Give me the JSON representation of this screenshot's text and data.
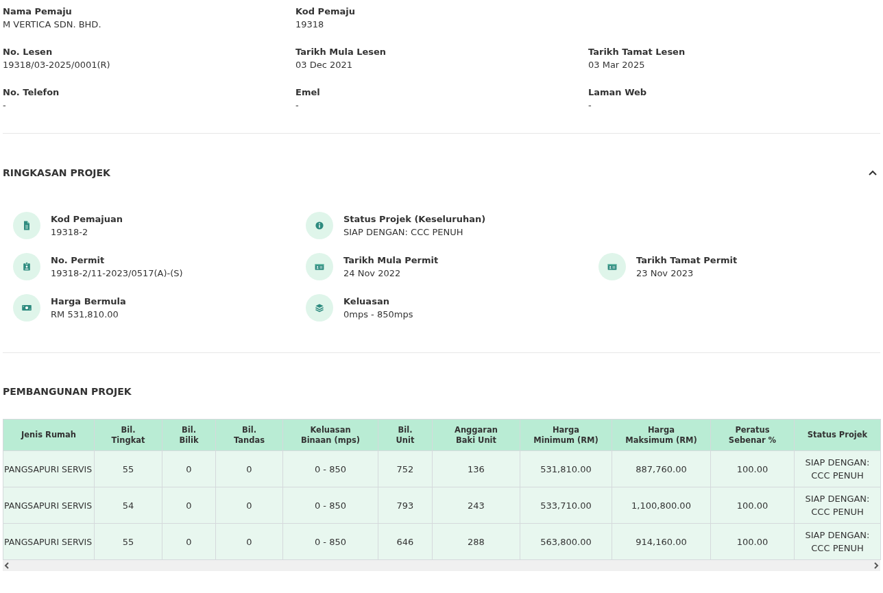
{
  "developer": {
    "rows": [
      [
        {
          "label": "Nama Pemaju",
          "value": "M VERTICA SDN. BHD."
        },
        {
          "label": "Kod Pemaju",
          "value": "19318"
        }
      ],
      [
        {
          "label": "No. Lesen",
          "value": "19318/03-2025/0001(R)"
        },
        {
          "label": "Tarikh Mula Lesen",
          "value": "03 Dec 2021"
        },
        {
          "label": "Tarikh Tamat Lesen",
          "value": "03 Mar 2025"
        }
      ],
      [
        {
          "label": "No. Telefon",
          "value": "-"
        },
        {
          "label": "Emel",
          "value": "-"
        },
        {
          "label": "Laman Web",
          "value": "-"
        }
      ]
    ]
  },
  "summary": {
    "title": "RINGKASAN PROJEK",
    "expanded": true,
    "rows": [
      [
        {
          "kind": "file",
          "label": "Kod Pemajuan",
          "value": "19318-2"
        },
        {
          "kind": "info",
          "label": "Status Projek (Keseluruhan)",
          "value": "SIAP DENGAN: CCC PENUH"
        }
      ],
      [
        {
          "kind": "badge",
          "label": "No. Permit",
          "value": "19318-2/11-2023/0517(A)-(S)"
        },
        {
          "kind": "card",
          "label": "Tarikh Mula Permit",
          "value": "24 Nov 2022"
        },
        {
          "kind": "card",
          "label": "Tarikh Tamat Permit",
          "value": "23 Nov 2023"
        }
      ],
      [
        {
          "kind": "money",
          "label": "Harga Bermula",
          "value": "RM 531,810.00"
        },
        {
          "kind": "layers",
          "label": "Keluasan",
          "value": "0mps - 850mps"
        }
      ]
    ]
  },
  "construction": {
    "title": "PEMBANGUNAN PROJEK",
    "table": {
      "columns": [
        "Jenis Rumah",
        "Bil.\nTingkat",
        "Bil.\nBilik",
        "Bil.\nTandas",
        "Keluasan\nBinaan (mps)",
        "Bil.\nUnit",
        "Anggaran\nBaki Unit",
        "Harga\nMinimum (RM)",
        "Harga\nMaksimum (RM)",
        "Peratus\nSebenar %",
        "Status Projek"
      ],
      "rows": [
        [
          "PANGSAPURI SERVIS",
          "55",
          "0",
          "0",
          "0 - 850",
          "752",
          "136",
          "531,810.00",
          "887,760.00",
          "100.00",
          "SIAP DENGAN: CCC PENUH"
        ],
        [
          "PANGSAPURI SERVIS",
          "54",
          "0",
          "0",
          "0 - 850",
          "793",
          "243",
          "533,710.00",
          "1,100,800.00",
          "100.00",
          "SIAP DENGAN: CCC PENUH"
        ],
        [
          "PANGSAPURI SERVIS",
          "55",
          "0",
          "0",
          "0 - 850",
          "646",
          "288",
          "563,800.00",
          "914,160.00",
          "100.00",
          "SIAP DENGAN: CCC PENUH"
        ]
      ]
    }
  }
}
